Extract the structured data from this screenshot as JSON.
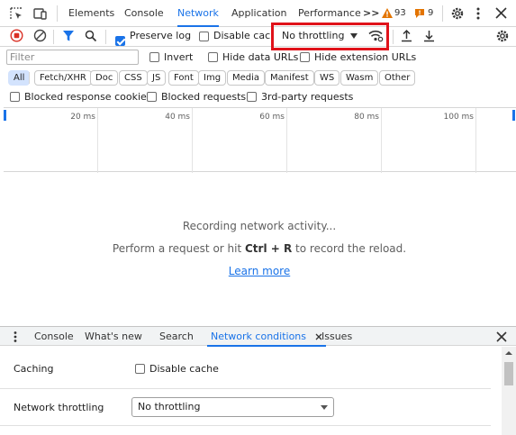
{
  "tabs": {
    "elements": "Elements",
    "console": "Console",
    "network": "Network",
    "application": "Application",
    "performance": "Performance",
    "more": ">>",
    "warn_count": "93",
    "issue_count": "9"
  },
  "toolbar": {
    "preserve_log": "Preserve log",
    "disable_cache": "Disable cache",
    "throttling": "No throttling"
  },
  "filter": {
    "placeholder": "Filter",
    "invert": "Invert",
    "hide_data_urls": "Hide data URLs",
    "hide_extension_urls": "Hide extension URLs"
  },
  "chips": [
    "All",
    "Fetch/XHR",
    "Doc",
    "CSS",
    "JS",
    "Font",
    "Img",
    "Media",
    "Manifest",
    "WS",
    "Wasm",
    "Other"
  ],
  "blocked": {
    "response_cookies": "Blocked response cookies",
    "requests": "Blocked requests",
    "third_party": "3rd-party requests"
  },
  "timeline": {
    "ticks": [
      "20 ms",
      "40 ms",
      "60 ms",
      "80 ms",
      "100 ms"
    ]
  },
  "empty_state": {
    "line1": "Recording network activity...",
    "line2_prefix": "Perform a request or hit ",
    "line2_shortcut": "Ctrl + R",
    "line2_suffix": " to record the reload.",
    "link": "Learn more"
  },
  "drawer": {
    "tabs": [
      "Console",
      "What's new",
      "Search",
      "Network conditions",
      "Issues"
    ],
    "caching_label": "Caching",
    "disable_cache": "Disable cache",
    "throttling_label": "Network throttling",
    "throttling_value": "No throttling"
  },
  "colors": {
    "accent": "#1a73e8",
    "highlight_box": "#e0121a",
    "record_red": "#d93025"
  }
}
